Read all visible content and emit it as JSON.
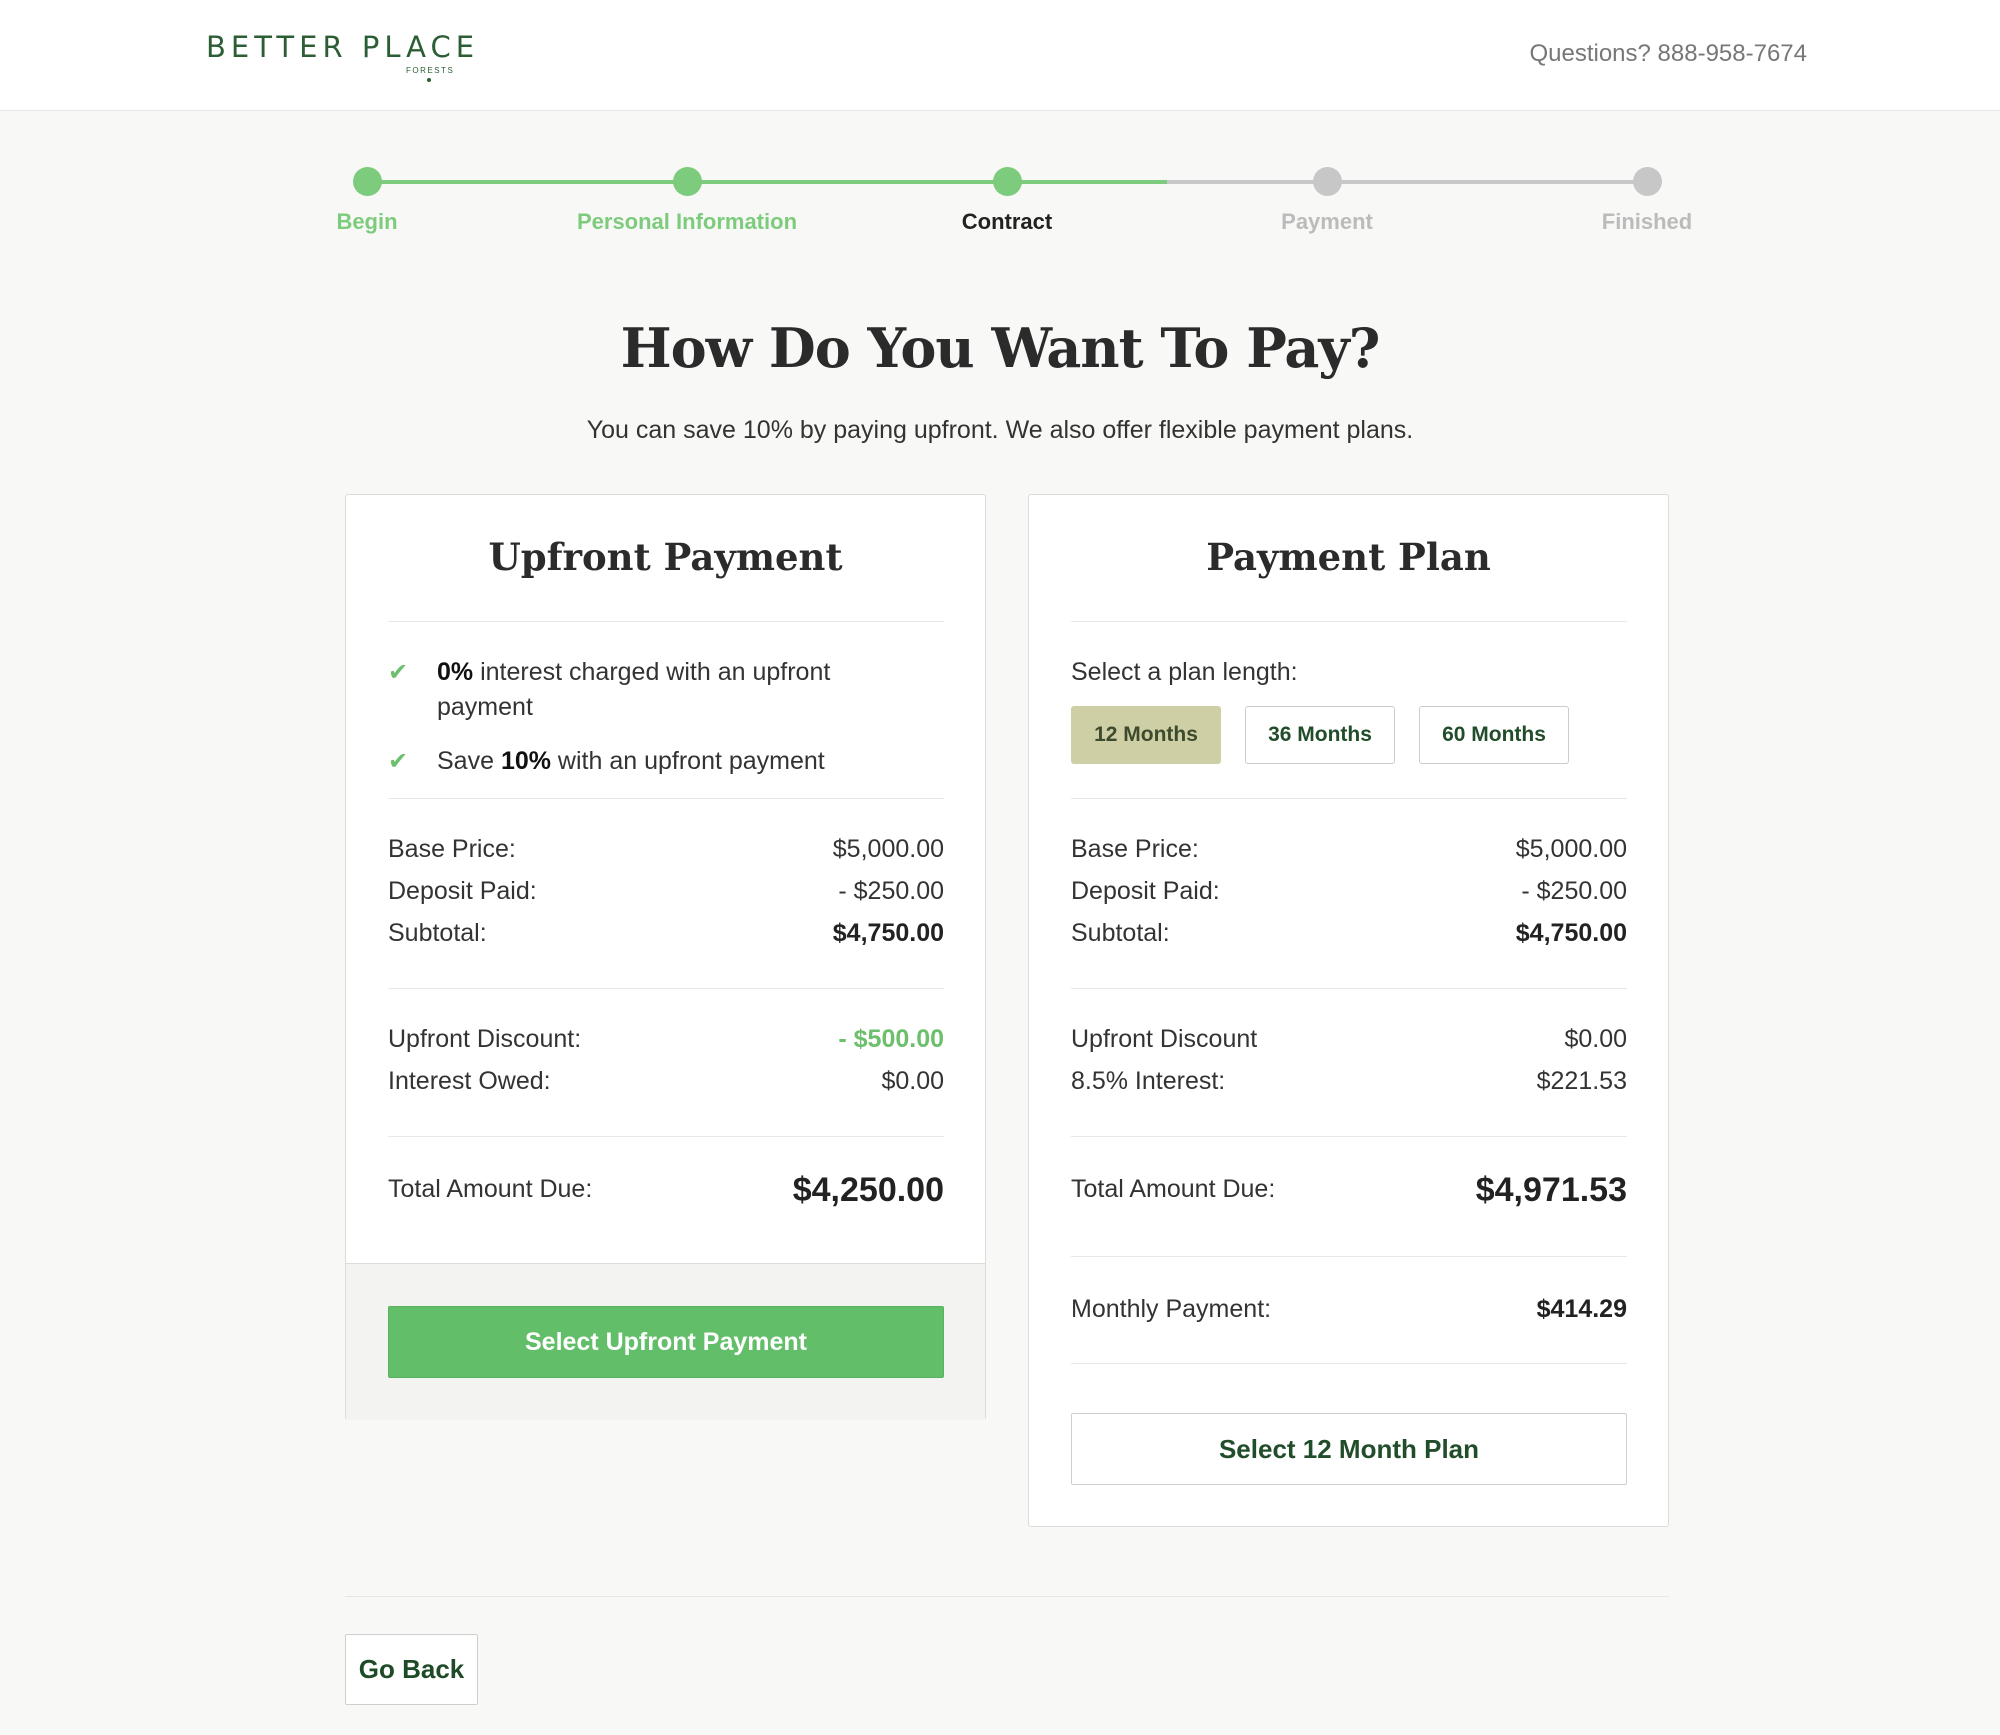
{
  "header": {
    "logo_text": "BETTER PLACE",
    "logo_sub": "FORESTS",
    "questions": "Questions? 888-958-7674"
  },
  "steps": [
    {
      "label": "Begin",
      "state": "done"
    },
    {
      "label": "Personal Information",
      "state": "done"
    },
    {
      "label": "Contract",
      "state": "current"
    },
    {
      "label": "Payment",
      "state": "todo"
    },
    {
      "label": "Finished",
      "state": "todo"
    }
  ],
  "page": {
    "title": "How Do You Want To Pay?",
    "subtitle": "You can save 10% by paying upfront. We also offer flexible payment plans."
  },
  "upfront": {
    "title": "Upfront Payment",
    "features": [
      {
        "bold": "0%",
        "rest": " interest charged with an upfront payment"
      },
      {
        "pre": "Save ",
        "bold": "10%",
        "rest": " with an upfront payment"
      }
    ],
    "base_price_label": "Base Price:",
    "base_price": "$5,000.00",
    "deposit_label": "Deposit Paid:",
    "deposit": "- $250.00",
    "subtotal_label": "Subtotal:",
    "subtotal": "$4,750.00",
    "discount_label": "Upfront Discount:",
    "discount": "- $500.00",
    "interest_label": "Interest Owed:",
    "interest": "$0.00",
    "total_label": "Total Amount Due:",
    "total": "$4,250.00",
    "button": "Select Upfront Payment"
  },
  "plan": {
    "title": "Payment Plan",
    "select_label": "Select a plan length:",
    "options": [
      "12 Months",
      "36 Months",
      "60 Months"
    ],
    "selected": "12 Months",
    "base_price_label": "Base Price:",
    "base_price": "$5,000.00",
    "deposit_label": "Deposit Paid:",
    "deposit": "- $250.00",
    "subtotal_label": "Subtotal:",
    "subtotal": "$4,750.00",
    "discount_label": "Upfront Discount",
    "discount": "$0.00",
    "interest_label": "8.5% Interest:",
    "interest": "$221.53",
    "total_label": "Total Amount Due:",
    "total": "$4,971.53",
    "monthly_label": "Monthly Payment:",
    "monthly": "$414.29",
    "button": "Select 12 Month Plan"
  },
  "footer": {
    "go_back": "Go Back"
  },
  "colors": {
    "brand_green": "#2c5e35",
    "accent_green": "#62be69",
    "progress_done": "#7dcc7d",
    "progress_todo": "#c7c7c7",
    "plan_selected_bg": "#cfcfa6"
  }
}
